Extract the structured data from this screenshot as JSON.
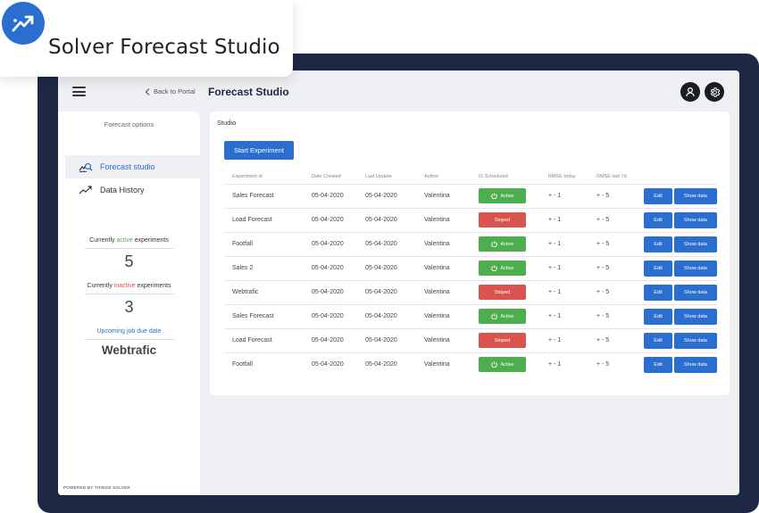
{
  "app": {
    "title": "Solver Forecast Studio",
    "logo_icon": "trend-up-icon",
    "brand_color": "#2a6fd0"
  },
  "topbar": {
    "menu_icon": "hamburger-icon",
    "back_label": "Back to Portal",
    "page_title": "Forecast Studio",
    "user_icon": "user-icon",
    "settings_icon": "gear-icon"
  },
  "sidebar": {
    "heading": "Forecast options",
    "items": [
      {
        "label": "Forecast studio",
        "icon": "forecast-search-icon",
        "active": true
      },
      {
        "label": "Data History",
        "icon": "trend-line-icon",
        "active": false
      }
    ],
    "active_label_pre": "Currently ",
    "active_word": "active",
    "active_label_post": " experiments",
    "active_count": "5",
    "inactive_label_pre": "Currently ",
    "inactive_word": "inactive",
    "inactive_label_post": " experiments",
    "inactive_count": "3",
    "upcoming_label": "Upcoming job due date",
    "upcoming_value": "Webtrafic",
    "powered_by": "POWERED BY THINGS SOLVER"
  },
  "studio": {
    "title": "Studio",
    "start_button": "Start Experiment",
    "columns": [
      "Experiment id",
      "Date Created",
      "Last Update",
      "Author",
      "IS Scheduled",
      "RMSE today",
      "RMSE last 7d",
      ""
    ],
    "edit_label": "Edit",
    "show_label": "Show data",
    "status_colors": {
      "Active": "#4cae4c",
      "Stoped": "#d9534f"
    },
    "rows": [
      {
        "id": "Sales Forecast",
        "created": "05-04-2020",
        "updated": "05-04-2020",
        "author": "Valentina",
        "status": "Active",
        "rmse_today": "+ - 1",
        "rmse_7d": "+ - 5"
      },
      {
        "id": "Load Forecast",
        "created": "05-04-2020",
        "updated": "05-04-2020",
        "author": "Valentina",
        "status": "Stoped",
        "rmse_today": "+ - 1",
        "rmse_7d": "+ - 5"
      },
      {
        "id": "Footfall",
        "created": "05-04-2020",
        "updated": "05-04-2020",
        "author": "Valentina",
        "status": "Active",
        "rmse_today": "+ - 1",
        "rmse_7d": "+ - 5"
      },
      {
        "id": "Sales 2",
        "created": "05-04-2020",
        "updated": "05-04-2020",
        "author": "Valentina",
        "status": "Active",
        "rmse_today": "+ - 1",
        "rmse_7d": "+ - 5"
      },
      {
        "id": "Webtrafic",
        "created": "05-04-2020",
        "updated": "05-04-2020",
        "author": "Valentina",
        "status": "Stoped",
        "rmse_today": "+ - 1",
        "rmse_7d": "+ - 5"
      },
      {
        "id": "Sales Forecast",
        "created": "05-04-2020",
        "updated": "05-04-2020",
        "author": "Valentina",
        "status": "Active",
        "rmse_today": "+ - 1",
        "rmse_7d": "+ - 5"
      },
      {
        "id": "Load Forecast",
        "created": "05-04-2020",
        "updated": "05-04-2020",
        "author": "Valentina",
        "status": "Stoped",
        "rmse_today": "+ - 1",
        "rmse_7d": "+ - 5"
      },
      {
        "id": "Footfall",
        "created": "05-04-2020",
        "updated": "05-04-2020",
        "author": "Valentina",
        "status": "Active",
        "rmse_today": "+ - 1",
        "rmse_7d": "+ - 5"
      }
    ]
  }
}
